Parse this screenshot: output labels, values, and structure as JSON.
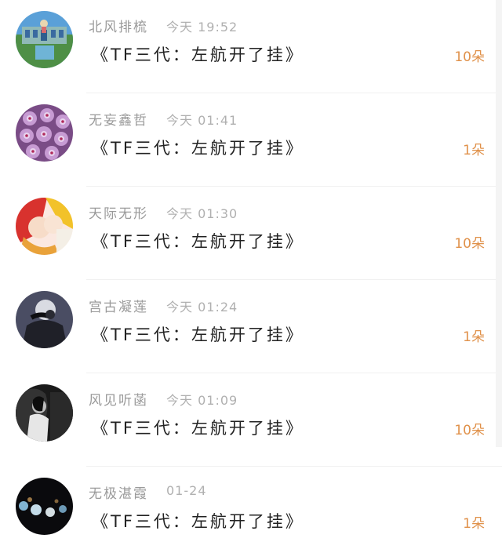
{
  "rows": [
    {
      "name": "北风排梳",
      "time": "今天 19:52",
      "message": "《TF三代：左航开了挂》",
      "count": "10朵",
      "avatar": "building-photo-avatar"
    },
    {
      "name": "无妄鑫哲",
      "time": "今天 01:41",
      "message": "《TF三代：左航开了挂》",
      "count": "1朵",
      "avatar": "purple-flower-avatar"
    },
    {
      "name": "天际无形",
      "time": "今天 01:30",
      "message": "《TF三代：左航开了挂》",
      "count": "10朵",
      "avatar": "anime-couple-avatar"
    },
    {
      "name": "宫古凝莲",
      "time": "今天 01:24",
      "message": "《TF三代：左航开了挂》",
      "count": "1朵",
      "avatar": "person-photo-avatar"
    },
    {
      "name": "风见听菡",
      "time": "今天 01:09",
      "message": "《TF三代：左航开了挂》",
      "count": "10朵",
      "avatar": "bw-portrait-avatar"
    },
    {
      "name": "无极湛霞",
      "time": "01-24",
      "message": "《TF三代：左航开了挂》",
      "count": "1朵",
      "avatar": "night-lights-avatar"
    }
  ],
  "colors": {
    "count_accent": "#e0914a",
    "name_gray": "#9a9a9a",
    "message_text": "#222222"
  }
}
